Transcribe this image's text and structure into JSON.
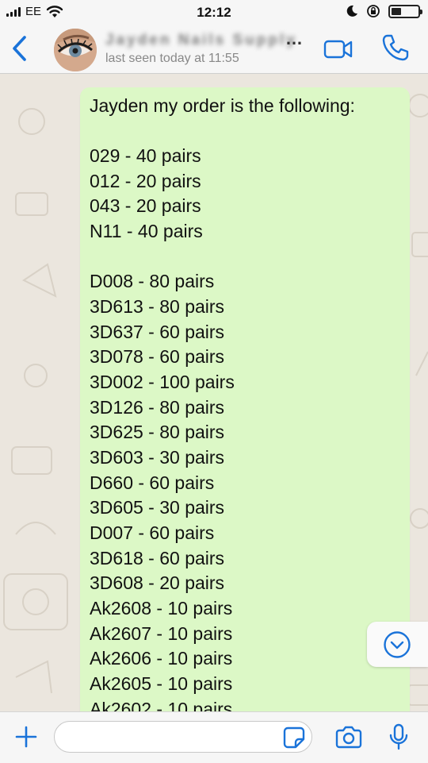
{
  "status_bar": {
    "carrier": "EE",
    "time": "12:12",
    "icons": [
      "signal-icon",
      "wifi-icon",
      "moon-icon",
      "orientation-lock-icon",
      "battery-icon"
    ]
  },
  "header": {
    "contact_name": "Jayden Nails Supply",
    "status": "last seen today at 11:55",
    "ellipsis": "…",
    "icons": [
      "back-chevron-icon",
      "avatar",
      "video-camera-icon",
      "phone-icon"
    ]
  },
  "message": {
    "intro": "Jayden my order is the following:",
    "group1": [
      "029 - 40 pairs",
      "012 - 20 pairs",
      "043 - 20 pairs",
      "N11 - 40 pairs"
    ],
    "group2": [
      "D008 - 80 pairs",
      "3D613 - 80 pairs",
      "3D637 - 60 pairs",
      "3D078 - 60 pairs",
      "3D002 - 100 pairs",
      "3D126 - 80 pairs",
      "3D625 - 80 pairs",
      "3D603 - 30 pairs",
      "D660 - 60 pairs",
      "3D605 - 30 pairs",
      "D007 - 60 pairs",
      "3D618 - 60 pairs",
      "3D608 - 20 pairs",
      "Ak2608 - 10 pairs",
      "Ak2607 - 10 pairs",
      "Ak2606 - 10 pairs",
      "Ak2605 - 10 pairs",
      "Ak2602 - 10 pairs"
    ]
  },
  "input_bar": {
    "placeholder": "",
    "icons": [
      "plus-icon",
      "sticker-icon",
      "camera-icon",
      "microphone-icon"
    ]
  },
  "colors": {
    "accent": "#1a73d9",
    "bubble": "#dcf8c6",
    "chat_background": "#ebe6de"
  }
}
